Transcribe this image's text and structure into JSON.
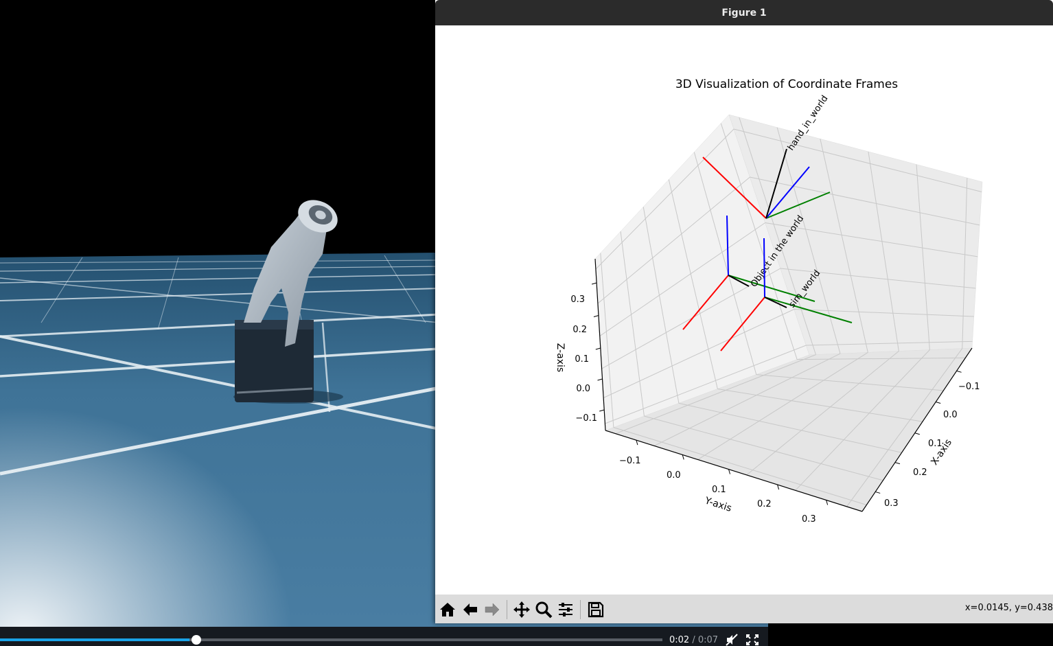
{
  "player": {
    "current_time": "0:02",
    "separator": " / ",
    "duration": "0:07",
    "progress": 0.2857,
    "icons": {
      "mute": "speaker-muted-icon",
      "fullscreen": "fullscreen-icon"
    }
  },
  "figure_window": {
    "title": "Figure 1",
    "toolbar": {
      "buttons": [
        "home-icon",
        "back-arrow-icon",
        "forward-arrow-icon",
        "pan-icon",
        "zoom-icon",
        "configure-subplots-icon",
        "save-icon"
      ],
      "coords_readout": "x=0.0145, y=0.438"
    }
  },
  "chart_data": {
    "type": "3d-line",
    "title": "3D Visualization of Coordinate Frames",
    "xlabel": "X-axis",
    "ylabel": "Y-axis",
    "zlabel": "Z-axis",
    "grid": true,
    "xticks": [
      "−0.1",
      "0.0",
      "0.1",
      "0.2",
      "0.3"
    ],
    "yticks": [
      "−0.1",
      "0.0",
      "0.1",
      "0.2",
      "0.3"
    ],
    "zticks": [
      "−0.1",
      "0.0",
      "0.1",
      "0.2",
      "0.3"
    ],
    "axis_colors": {
      "x": "#ff0000",
      "y": "#008000",
      "z": "#0000ff",
      "marker": "#000000"
    },
    "frames": [
      {
        "name": "hand_in_world"
      },
      {
        "name": "Object in the world"
      },
      {
        "name": "sim_world"
      }
    ]
  }
}
